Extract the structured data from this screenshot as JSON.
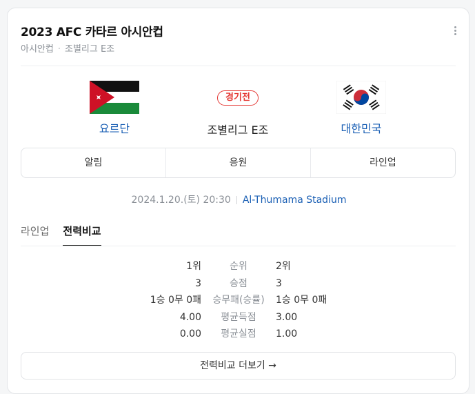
{
  "header": {
    "title": "2023 AFC 카타르 아시안컵",
    "breadcrumb": [
      "아시안컵",
      "조별리그 E조"
    ]
  },
  "match": {
    "home": {
      "name": "요르단",
      "flag": "jordan-flag"
    },
    "away": {
      "name": "대한민국",
      "flag": "korea-flag"
    },
    "status": "경기전",
    "group": "조별리그 E조",
    "datetime": "2024.1.20.(토) 20:30",
    "stadium": "Al-Thumama Stadium"
  },
  "actions": [
    "알림",
    "응원",
    "라인업"
  ],
  "tabs": [
    "라인업",
    "전력비교"
  ],
  "active_tab": "전력비교",
  "stats": [
    {
      "label": "순위",
      "home": "1위",
      "away": "2위"
    },
    {
      "label": "승점",
      "home": "3",
      "away": "3"
    },
    {
      "label": "승무패(승률)",
      "home": "1승 0무 0패",
      "away": "1승 0무 0패"
    },
    {
      "label": "평균득점",
      "home": "4.00",
      "away": "3.00"
    },
    {
      "label": "평균실점",
      "home": "0.00",
      "away": "1.00"
    }
  ],
  "more_link": "전력비교 더보기 →",
  "colors": {
    "accent_blue": "#1a5fb4",
    "status_red": "#e53935"
  }
}
